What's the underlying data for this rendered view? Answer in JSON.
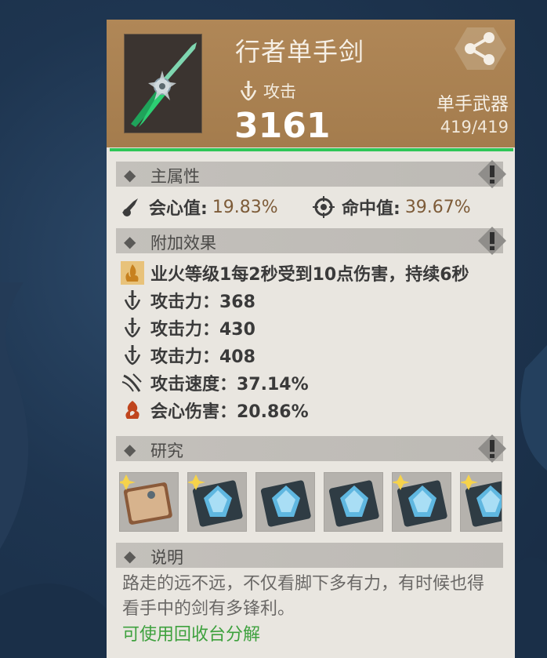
{
  "item": {
    "name": "行者单手剑",
    "stat_label": "攻击",
    "stat_value": "3161",
    "type": "单手武器",
    "durability": "419/419"
  },
  "sections": {
    "main": {
      "title": "主属性"
    },
    "bonus": {
      "title": "附加效果"
    },
    "research": {
      "title": "研究"
    },
    "description": {
      "title": "说明"
    }
  },
  "main_stats": [
    {
      "label": "会心值:",
      "value": "19.83%",
      "icon": "crit-icon"
    },
    {
      "label": "命中值:",
      "value": "39.67%",
      "icon": "accuracy-icon"
    }
  ],
  "bonus_effects": [
    {
      "text": "业火等级1每2秒受到10点伤害，持续6秒",
      "icon": "hellfire-icon"
    },
    {
      "text": "攻击力：368",
      "icon": "attack-icon"
    },
    {
      "text": "攻击力：430",
      "icon": "attack-icon"
    },
    {
      "text": "攻击力：408",
      "icon": "attack-icon"
    },
    {
      "text": "攻击速度：37.14%",
      "icon": "attack-speed-icon"
    },
    {
      "text": "会心伤害：20.86%",
      "icon": "crit-damage-icon"
    }
  ],
  "research_books": [
    {
      "kind": "leather-book",
      "starred": true
    },
    {
      "kind": "blue-crystal-book",
      "starred": true
    },
    {
      "kind": "blue-crystal-book",
      "starred": false
    },
    {
      "kind": "blue-crystal-book",
      "starred": false
    },
    {
      "kind": "blue-crystal-book",
      "starred": true
    },
    {
      "kind": "blue-crystal-book",
      "starred": true
    }
  ],
  "description": {
    "text": "路走的远不远，不仅看脚下多有力，有时候也得看手中的剑有多锋利。",
    "action": "可使用回收台分解"
  },
  "colors": {
    "header": "#a47c4d",
    "accent_green": "#2fc657",
    "action_green": "#3ea13e",
    "panel": "#e9e6e0"
  }
}
